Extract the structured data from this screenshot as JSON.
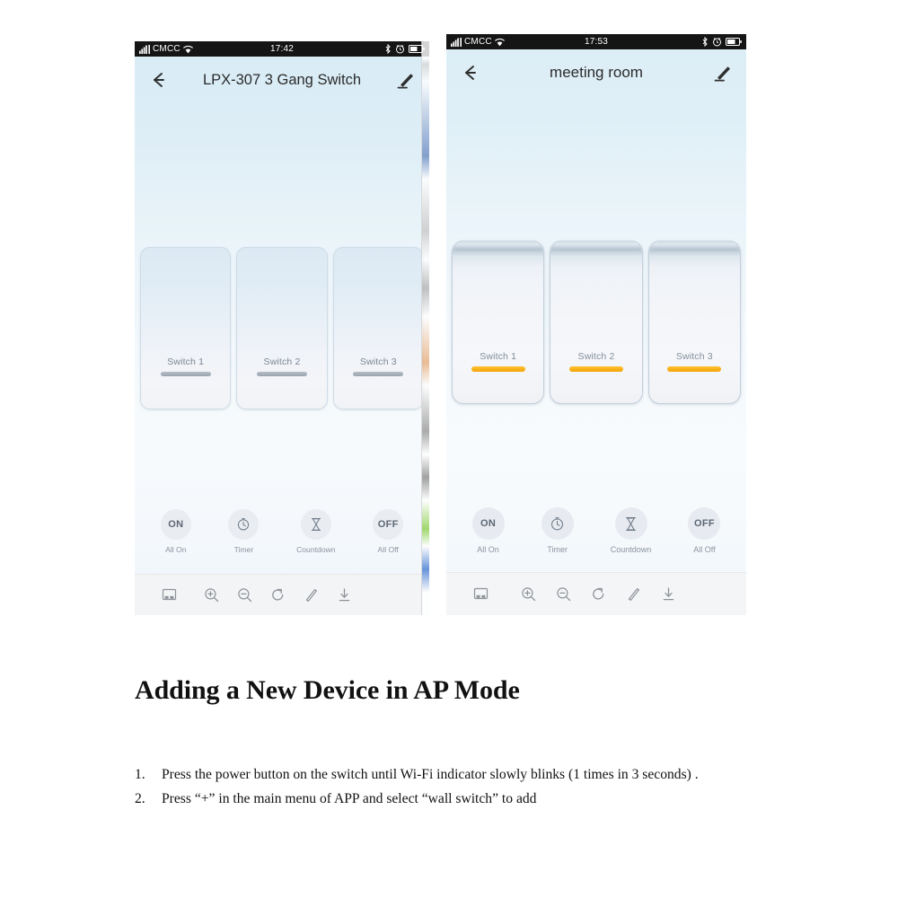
{
  "phones": [
    {
      "id": "device-detail",
      "status_bar": {
        "carrier": "CMCC",
        "time": "17:42",
        "signal_icon": "cellular-signal-icon",
        "wifi_icon": "wifi-icon",
        "bluetooth_icon": "bluetooth-icon",
        "alarm_icon": "alarm-clock-icon",
        "battery_icon": "battery-icon"
      },
      "header": {
        "back_icon": "back-arrow-icon",
        "title": "LPX-307 3 Gang Switch",
        "edit_icon": "edit-pencil-icon"
      },
      "switches": [
        {
          "label": "Switch 1",
          "state": "off"
        },
        {
          "label": "Switch 2",
          "state": "off"
        },
        {
          "label": "Switch 3",
          "state": "off"
        }
      ],
      "actions": [
        {
          "glyph": "ON",
          "label": "All On",
          "icon": "all-on-icon"
        },
        {
          "glyph": "",
          "label": "Timer",
          "icon": "clock-icon"
        },
        {
          "glyph": "",
          "label": "Countdown",
          "icon": "hourglass-icon"
        },
        {
          "glyph": "OFF",
          "label": "All Off",
          "icon": "all-off-icon"
        }
      ],
      "viewer_toolbar": [
        {
          "icon": "fit-page-icon"
        },
        {
          "icon": "zoom-in-icon"
        },
        {
          "icon": "zoom-out-icon"
        },
        {
          "icon": "rotate-right-icon"
        },
        {
          "icon": "annotate-pencil-icon"
        },
        {
          "icon": "download-icon"
        }
      ]
    },
    {
      "id": "room-detail",
      "status_bar": {
        "carrier": "CMCC",
        "time": "17:53",
        "signal_icon": "cellular-signal-icon",
        "wifi_icon": "wifi-icon",
        "bluetooth_icon": "bluetooth-icon",
        "alarm_icon": "alarm-clock-icon",
        "battery_icon": "battery-icon"
      },
      "header": {
        "back_icon": "back-arrow-icon",
        "title": "meeting room",
        "edit_icon": "edit-pencil-icon"
      },
      "switches": [
        {
          "label": "Switch 1",
          "state": "on"
        },
        {
          "label": "Switch 2",
          "state": "on"
        },
        {
          "label": "Switch 3",
          "state": "on"
        }
      ],
      "actions": [
        {
          "glyph": "ON",
          "label": "All On",
          "icon": "all-on-icon"
        },
        {
          "glyph": "",
          "label": "Timer",
          "icon": "clock-icon"
        },
        {
          "glyph": "",
          "label": "Countdown",
          "icon": "hourglass-icon"
        },
        {
          "glyph": "OFF",
          "label": "All Off",
          "icon": "all-off-icon"
        }
      ],
      "viewer_toolbar": [
        {
          "icon": "fit-page-icon"
        },
        {
          "icon": "zoom-in-icon"
        },
        {
          "icon": "zoom-out-icon"
        },
        {
          "icon": "rotate-right-icon"
        },
        {
          "icon": "annotate-pencil-icon"
        },
        {
          "icon": "download-icon"
        }
      ]
    }
  ],
  "document": {
    "title": "Adding a New Device in AP Mode",
    "steps": [
      {
        "num": "1.",
        "text": "Press the power button on the switch until Wi-Fi indicator slowly blinks (1 times in 3 seconds) ."
      },
      {
        "num": "2.",
        "text": "Press “+” in the main menu of APP and select “wall switch” to add"
      }
    ]
  },
  "colors": {
    "on_indicator": "#f3a50c",
    "off_indicator": "#9aa4ae",
    "screen_top": "#d9ecf5",
    "status_bar": "#151515",
    "toolbar_bg": "#f3f4f5"
  }
}
